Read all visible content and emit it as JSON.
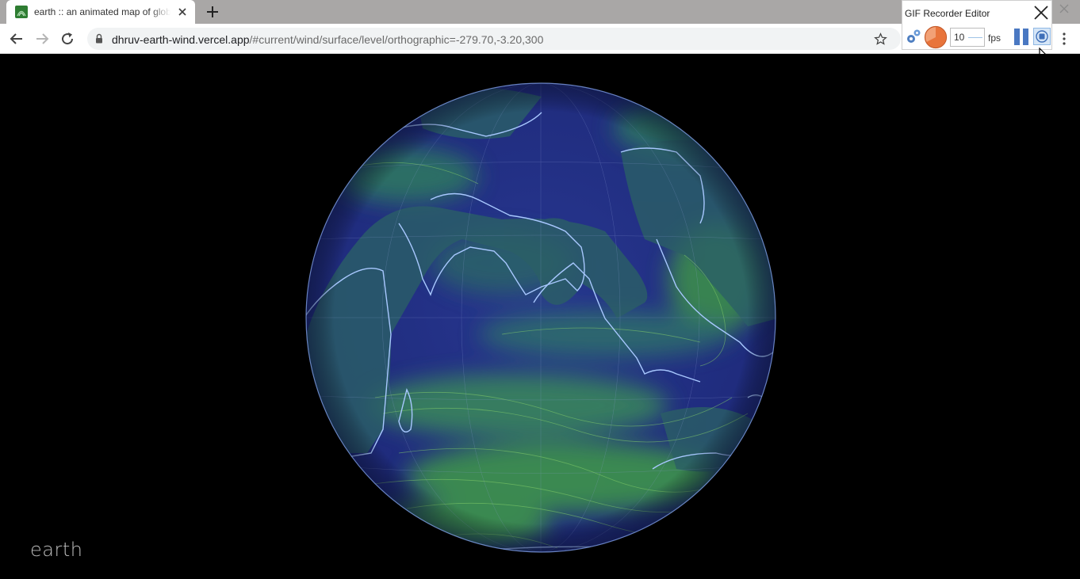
{
  "browser": {
    "tab": {
      "title": "earth :: an animated map of global wind and weather"
    },
    "address_bar": {
      "host": "dhruv-earth-wind.vercel.app",
      "path": "/#current/wind/surface/level/orthographic=-279.70,-3.20,300"
    }
  },
  "gif_recorder": {
    "title": "GIF Recorder Editor",
    "fps_value": "10",
    "fps_label": "fps"
  },
  "page": {
    "brand": "earth"
  },
  "colors": {
    "ocean": "#23308a",
    "land": "#2d6b62",
    "wind_fast": "#5ab43c",
    "coast": "#a8c8ff",
    "recorder_orange": "#e8743b"
  }
}
